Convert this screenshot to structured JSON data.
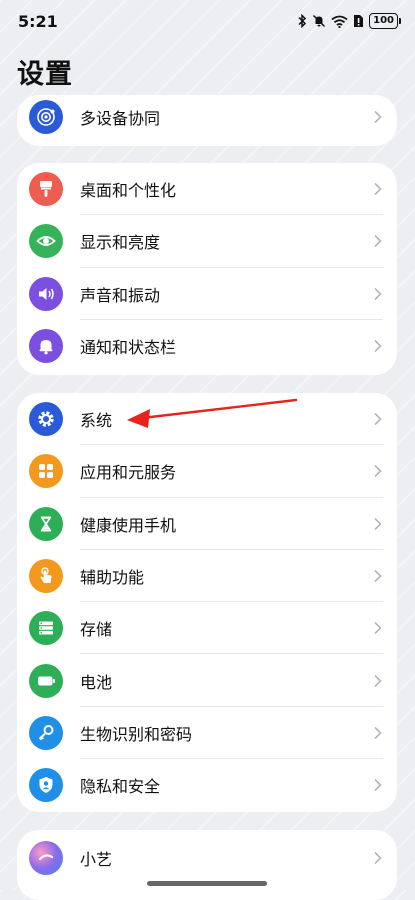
{
  "status": {
    "time": "5:21",
    "battery": "100"
  },
  "page": {
    "title": "设置"
  },
  "cards": [
    {
      "items": [
        {
          "label": "多设备协同",
          "icon": "multi-device-icon",
          "color": "#2a5bd7"
        }
      ]
    },
    {
      "items": [
        {
          "label": "桌面和个性化",
          "icon": "paint-brush-icon",
          "color": "#ee5d4f"
        },
        {
          "label": "显示和亮度",
          "icon": "eye-icon",
          "color": "#35b35b"
        },
        {
          "label": "声音和振动",
          "icon": "speaker-icon",
          "color": "#7b4fe0"
        },
        {
          "label": "通知和状态栏",
          "icon": "bell-icon",
          "color": "#7b4fe0"
        }
      ]
    },
    {
      "items": [
        {
          "label": "系统",
          "icon": "gear-icon",
          "color": "#2a5bd7"
        },
        {
          "label": "应用和元服务",
          "icon": "apps-grid-icon",
          "color": "#f39a1e"
        },
        {
          "label": "健康使用手机",
          "icon": "hourglass-icon",
          "color": "#2fae58"
        },
        {
          "label": "辅助功能",
          "icon": "hand-tap-icon",
          "color": "#f39a1e"
        },
        {
          "label": "存储",
          "icon": "storage-icon",
          "color": "#2fae58"
        },
        {
          "label": "电池",
          "icon": "battery-icon",
          "color": "#2fae58"
        },
        {
          "label": "生物识别和密码",
          "icon": "key-icon",
          "color": "#1f8fe8"
        },
        {
          "label": "隐私和安全",
          "icon": "privacy-shield-icon",
          "color": "#1f8fe8"
        }
      ]
    },
    {
      "items": [
        {
          "label": "小艺",
          "icon": "xiaoyi-icon",
          "color": "#8a6ae8"
        }
      ]
    }
  ],
  "annotation_color": "#e8231e"
}
